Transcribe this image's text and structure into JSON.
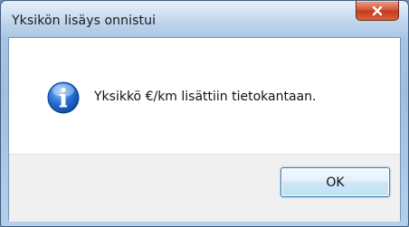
{
  "window": {
    "title": "Yksikön lisäys onnistui",
    "close_icon": "close-icon"
  },
  "dialog": {
    "icon": "info-icon",
    "message": "Yksikkö €/km lisättiin tietokantaan.",
    "ok_label": "OK"
  },
  "colors": {
    "titlebar": "#a9c6e6",
    "close_button": "#c94424",
    "info_icon": "#1e63c4",
    "footer": "#f0f0f0",
    "ok_border": "#3c7fb1"
  }
}
